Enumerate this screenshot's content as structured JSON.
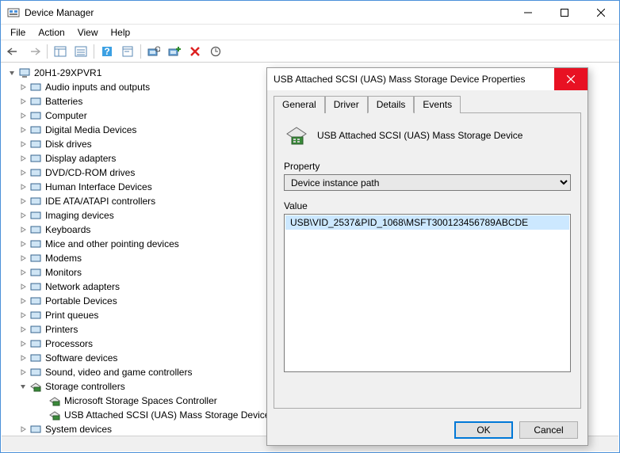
{
  "window": {
    "title": "Device Manager",
    "menus": [
      "File",
      "Action",
      "View",
      "Help"
    ]
  },
  "tree": {
    "root": "20H1-29XPVR1",
    "categories": [
      "Audio inputs and outputs",
      "Batteries",
      "Computer",
      "Digital Media Devices",
      "Disk drives",
      "Display adapters",
      "DVD/CD-ROM drives",
      "Human Interface Devices",
      "IDE ATA/ATAPI controllers",
      "Imaging devices",
      "Keyboards",
      "Mice and other pointing devices",
      "Modems",
      "Monitors",
      "Network adapters",
      "Portable Devices",
      "Print queues",
      "Printers",
      "Processors",
      "Software devices",
      "Sound, video and game controllers",
      "Storage controllers",
      "System devices"
    ],
    "storage_children": [
      "Microsoft Storage Spaces Controller",
      "USB Attached SCSI (UAS) Mass Storage Device"
    ]
  },
  "dialog": {
    "title": "USB Attached SCSI (UAS) Mass Storage Device Properties",
    "tabs": [
      "General",
      "Driver",
      "Details",
      "Events"
    ],
    "active_tab": "Details",
    "device_name": "USB Attached SCSI (UAS) Mass Storage Device",
    "property_label": "Property",
    "property_value": "Device instance path",
    "value_label": "Value",
    "value_text": "USB\\VID_2537&PID_1068\\MSFT300123456789ABCDE",
    "ok": "OK",
    "cancel": "Cancel"
  }
}
